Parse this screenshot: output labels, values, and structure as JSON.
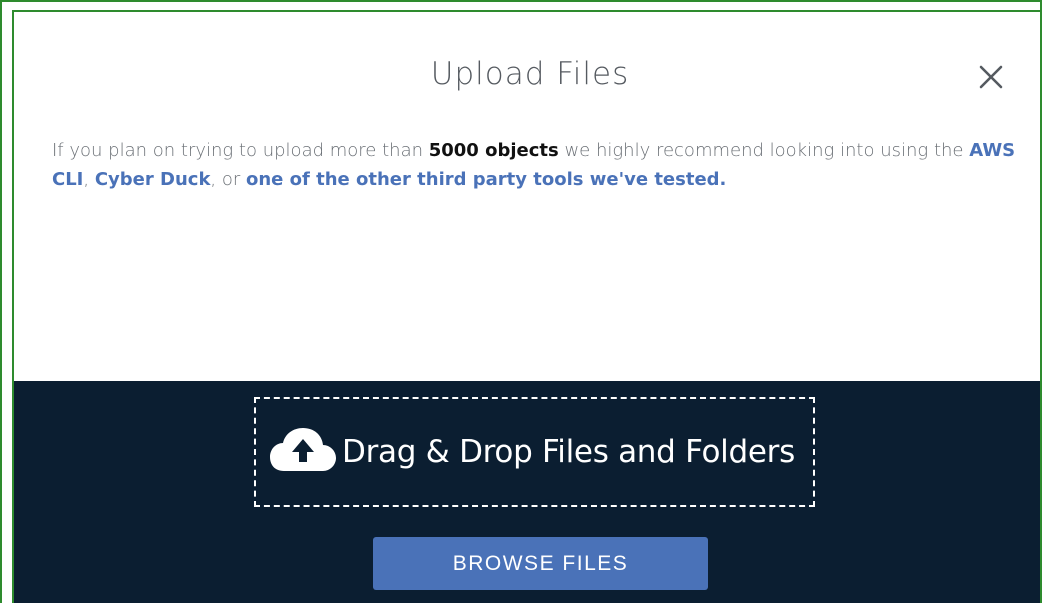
{
  "dialog": {
    "title": "Upload Files",
    "close_label": "×"
  },
  "notice": {
    "prefix": "If you plan on trying to upload more than ",
    "emphasis": "5000 objects",
    "middle": " we highly recommend looking into using the ",
    "link_aws_cli": "AWS CLI",
    "comma_1": ", ",
    "link_cyber_duck": "Cyber Duck",
    "comma_2": ", or ",
    "link_other_tools": "one of the other third party tools we've tested."
  },
  "dropzone": {
    "label": "Drag & Drop Files and Folders",
    "icon": "cloud-upload-icon"
  },
  "browse": {
    "label": "BROWSE FILES"
  },
  "colors": {
    "accent": "#4a72b8",
    "dropzone_bg": "#0b1e31",
    "frame_border": "#2e8b2e"
  }
}
